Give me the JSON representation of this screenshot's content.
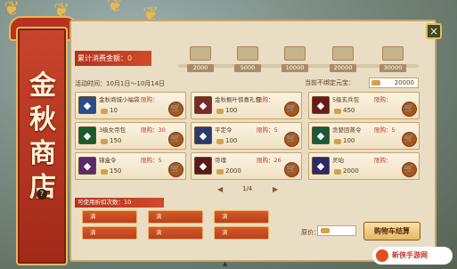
{
  "banner": {
    "title": "金秋商店",
    "help_label": "?"
  },
  "top": {
    "consume_label": "累计消费金额：",
    "consume_value": "0",
    "milestones": [
      {
        "value": "2000"
      },
      {
        "value": "5000"
      },
      {
        "value": "10000"
      },
      {
        "value": "20000"
      },
      {
        "value": "30000"
      }
    ]
  },
  "info": {
    "time_label": "活动时间：10月1日～10月14日",
    "balance_label": "当前不绑定元宝：",
    "balance_value": "20000"
  },
  "items": [
    {
      "name": "金秋商城小福袋",
      "limit": "限购：",
      "price": "10",
      "icon_color": "#2a4c8a",
      "icon": "◆",
      "cart": "🛒"
    },
    {
      "name": "金秋枫叶惊喜礼包",
      "limit": "限购：",
      "price": "100",
      "icon_color": "#7a2a2a",
      "icon": "◆",
      "cart": "🛒"
    },
    {
      "name": "5级玄兵包",
      "limit": "限购：",
      "price": "450",
      "icon_color": "#6a1a1a",
      "icon": "◆",
      "cart": "🛒"
    },
    {
      "name": "3级女帝包",
      "limit": "限购：30",
      "price": "150",
      "icon_color": "#1a5a2a",
      "icon": "◆",
      "cart": "🛒"
    },
    {
      "name": "平定令",
      "limit": "限购：5",
      "price": "100",
      "icon_color": "#2a3a6a",
      "icon": "◆",
      "cart": "🛒"
    },
    {
      "name": "贪婪回蒸令",
      "limit": "限购：5",
      "price": "100",
      "icon_color": "#1a5a3a",
      "icon": "◆",
      "cart": "🛒"
    },
    {
      "name": "锦盒令",
      "limit": "限购：5",
      "price": "150",
      "icon_color": "#5a2a6a",
      "icon": "◆",
      "cart": "🛒"
    },
    {
      "name": "帝魂",
      "limit": "限购：26",
      "price": "2000",
      "icon_color": "#5a1a1a",
      "icon": "◆",
      "cart": "🛒"
    },
    {
      "name": "灵珀",
      "limit": "限购：",
      "price": "2000",
      "icon_color": "#2a2a6a",
      "icon": "◆",
      "cart": "🛒"
    }
  ],
  "pager": {
    "prev": "◀",
    "next": "▶",
    "page_text": "1/4"
  },
  "discount": {
    "label": "可使用折扣次数：10",
    "buttons": [
      {
        "label": "满",
        "extra": ""
      },
      {
        "label": "满",
        "extra": ""
      },
      {
        "label": "满",
        "extra": ""
      },
      {
        "label": "满",
        "extra": ""
      },
      {
        "label": "满",
        "extra": ""
      },
      {
        "label": "满",
        "extra": ""
      },
      {
        "label": "满",
        "extra": ""
      },
      {
        "label": "满",
        "extra": ""
      }
    ]
  },
  "footer": {
    "total_label": "原价：",
    "checkout_label": "购物车结算",
    "close_label": "×"
  },
  "watermark": {
    "text": "新侠手游网"
  }
}
